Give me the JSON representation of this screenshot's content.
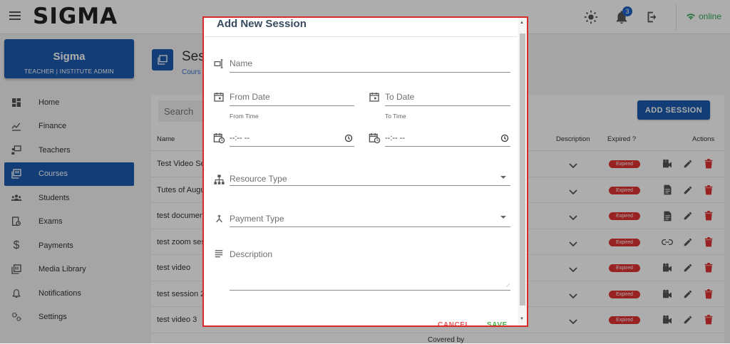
{
  "app": {
    "logo": "SIGMA"
  },
  "topbar": {
    "notification_count": "3",
    "status": "online"
  },
  "profile": {
    "name": "Sigma",
    "role": "TEACHER | INSTITUTE ADMIN"
  },
  "nav": [
    {
      "label": "Home",
      "icon": "dashboard-icon"
    },
    {
      "label": "Finance",
      "icon": "finance-chart-icon"
    },
    {
      "label": "Teachers",
      "icon": "teacher-icon"
    },
    {
      "label": "Courses",
      "icon": "courses-icon",
      "active": true
    },
    {
      "label": "Students",
      "icon": "students-icon"
    },
    {
      "label": "Exams",
      "icon": "exams-icon"
    },
    {
      "label": "Payments",
      "icon": "dollar-icon"
    },
    {
      "label": "Media Library",
      "icon": "media-library-icon"
    },
    {
      "label": "Notifications",
      "icon": "bell-icon"
    },
    {
      "label": "Settings",
      "icon": "gear-icon"
    }
  ],
  "page": {
    "title": "Ses",
    "breadcrumb": "Cours"
  },
  "toolbar": {
    "search_placeholder": "Search",
    "add_label": "ADD SESSION"
  },
  "table": {
    "headers": {
      "name": "Name",
      "description": "Description",
      "expired": "Expired ?",
      "actions": "Actions"
    },
    "rows": [
      {
        "name": "Test Video Se",
        "expired": "Expired",
        "type_icon": "video-camera-icon"
      },
      {
        "name": "Tutes of Augu",
        "expired": "Expired",
        "type_icon": "document-icon"
      },
      {
        "name": "test documen",
        "expired": "Expired",
        "type_icon": "document-icon"
      },
      {
        "name": "test zoom ses",
        "expired": "Expired",
        "type_icon": "link-icon"
      },
      {
        "name": "test video",
        "expired": "Expired",
        "type_icon": "video-camera-icon"
      },
      {
        "name": "test session 2",
        "expired": "Expired",
        "type_icon": "video-camera-icon"
      },
      {
        "name": "test video 3",
        "expired": "Expired",
        "type_icon": "video-camera-icon"
      }
    ],
    "partial_text": "Covered by"
  },
  "dialog": {
    "title": "Add New Session",
    "name_placeholder": "Name",
    "from_date_placeholder": "From Date",
    "to_date_placeholder": "To Date",
    "from_time_label": "From Time",
    "from_time_value": "--:-- --",
    "to_time_label": "To Time",
    "to_time_value": "--:-- --",
    "resource_type_placeholder": "Resource Type",
    "payment_type_placeholder": "Payment Type",
    "description_placeholder": "Description",
    "cancel_label": "CANCEL",
    "save_label": "SAVE"
  },
  "colors": {
    "primary": "#1c5ab0",
    "danger": "#e03131",
    "success": "#34a853",
    "dialog_border": "#d92a2a"
  }
}
